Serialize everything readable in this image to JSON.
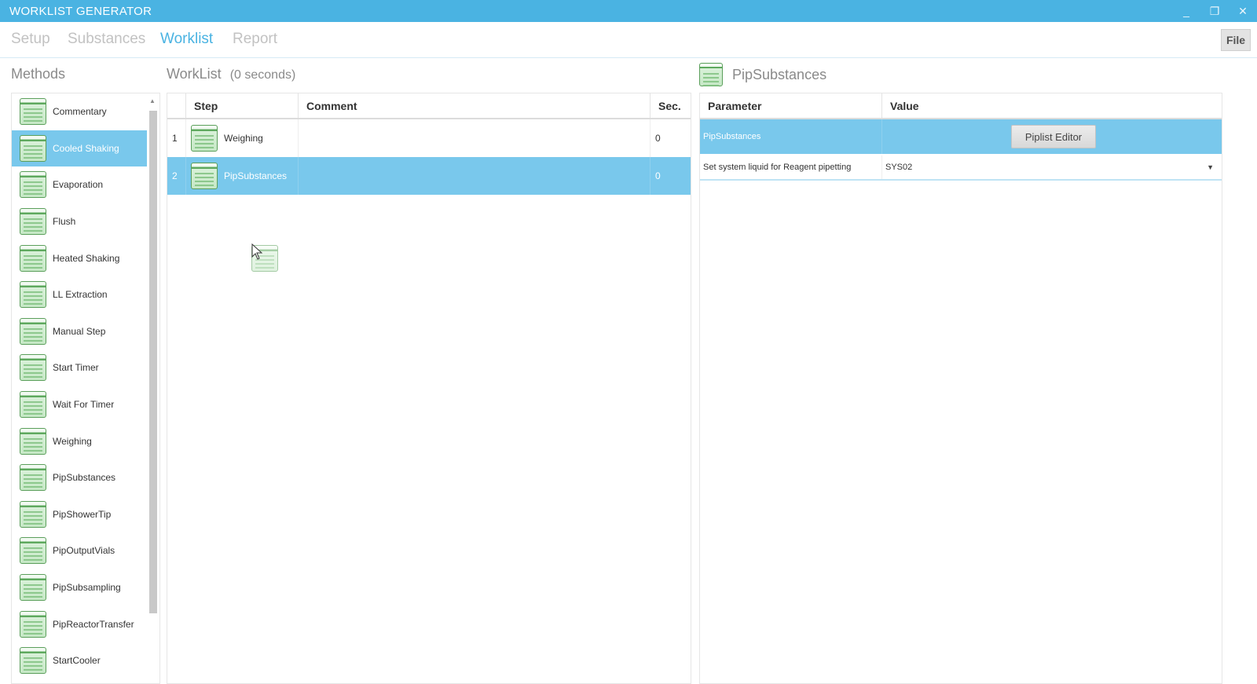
{
  "window": {
    "title": "WORKLIST GENERATOR",
    "minimize_glyph": "_",
    "restore_glyph": "❐",
    "close_glyph": "✕"
  },
  "menu": {
    "tabs": [
      {
        "label": "Setup",
        "active": false
      },
      {
        "label": "Substances",
        "active": false
      },
      {
        "label": "Worklist",
        "active": true
      },
      {
        "label": "Report",
        "active": false
      }
    ],
    "file_label": "File"
  },
  "methods": {
    "title": "Methods",
    "items": [
      {
        "label": "Commentary",
        "icon": "method-book-icon"
      },
      {
        "label": "Cooled Shaking",
        "icon": "method-book-icon",
        "selected": true
      },
      {
        "label": "Evaporation",
        "icon": "method-book-icon"
      },
      {
        "label": "Flush",
        "icon": "method-book-icon"
      },
      {
        "label": "Heated Shaking",
        "icon": "method-book-icon"
      },
      {
        "label": "LL Extraction",
        "icon": "method-book-icon"
      },
      {
        "label": "Manual Step",
        "icon": "method-book-icon"
      },
      {
        "label": "Start Timer",
        "icon": "method-book-icon"
      },
      {
        "label": "Wait For Timer",
        "icon": "method-book-icon"
      },
      {
        "label": "Weighing",
        "icon": "method-book-icon"
      },
      {
        "label": "PipSubstances",
        "icon": "method-book-icon"
      },
      {
        "label": "PipShowerTip",
        "icon": "method-book-icon"
      },
      {
        "label": "PipOutputVials",
        "icon": "method-book-icon"
      },
      {
        "label": "PipSubsampling",
        "icon": "method-book-icon"
      },
      {
        "label": "PipReactorTransfer",
        "icon": "method-book-icon"
      },
      {
        "label": "StartCooler",
        "icon": "method-book-icon"
      }
    ]
  },
  "worklist": {
    "title": "WorkList",
    "duration": "(0 seconds)",
    "columns": {
      "step": "Step",
      "comment": "Comment",
      "sec": "Sec."
    },
    "rows": [
      {
        "index": "1",
        "step": "Weighing",
        "comment": "",
        "sec": "0",
        "selected": false
      },
      {
        "index": "2",
        "step": "PipSubstances",
        "comment": "",
        "sec": "0",
        "selected": true
      }
    ]
  },
  "properties": {
    "title": "PipSubstances",
    "columns": {
      "parameter": "Parameter",
      "value": "Value"
    },
    "rows": [
      {
        "parameter": "PipSubstances",
        "value_button": "Piplist Editor",
        "selected": true
      },
      {
        "parameter": "Set system liquid for Reagent pipetting",
        "value": "SYS02",
        "selected": false
      }
    ]
  },
  "colors": {
    "title_bar": "#4ab3e2",
    "selection": "#79c8ec",
    "active_tab": "#4ab3e2",
    "inactive_tab": "#c2c2c2"
  }
}
